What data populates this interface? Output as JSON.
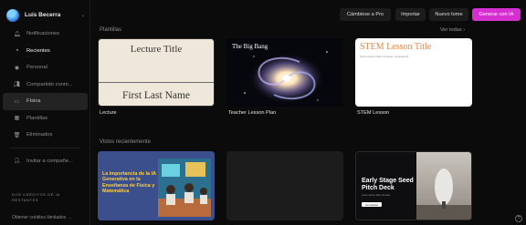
{
  "user": {
    "name": "Luis Becerra"
  },
  "sidebar": {
    "items": [
      {
        "label": "Notificaciones",
        "icon": "bell-icon"
      },
      {
        "label": "Recientes",
        "icon": "clock-icon"
      },
      {
        "label": "Personal",
        "icon": "person-icon"
      },
      {
        "label": "Compartido conm...",
        "icon": "people-icon"
      },
      {
        "label": "Física",
        "icon": "folder-icon"
      },
      {
        "label": "Plantillas",
        "icon": "grid-icon"
      },
      {
        "label": "Eliminados",
        "icon": "trash-icon"
      },
      {
        "label": "Invitar a compañe...",
        "icon": "invite-icon"
      }
    ],
    "credits_text": "DOS CRÉDITOS DE IA RESTANTES",
    "credits_link": "Obtener créditos ilimitados →"
  },
  "topbar": {
    "upgrade_label": "Cámbiese a Pro",
    "import_label": "Importar",
    "new_label": "Nuevo tome",
    "generate_label": "Generar con IA",
    "generate_color": "#d62fd0"
  },
  "templates": {
    "section_label": "Plantillas",
    "see_all": "Ver todas ›",
    "cards": [
      {
        "caption": "Lecture",
        "thumb_title": "Lecture Title",
        "thumb_footer": "First Last Name"
      },
      {
        "caption": "Teacher Lesson Plan",
        "thumb_title": "The Big Bang"
      },
      {
        "caption": "STEM Lesson",
        "thumb_title": "STEM Lesson Title",
        "thumb_sub": "Lorem ipsum dolor sit amet, consectetur"
      }
    ]
  },
  "recent": {
    "section_label": "Vistos recientemente",
    "cards": [
      {
        "thumb_title": "La Importancia de la IA Generativa en la Enseñanza de Física y Matemática"
      },
      {
        "thumb_title": ""
      },
      {
        "thumb_title": "Early Stage Seed Pitch Deck",
        "thumb_sub": "Lorem ipsum dolor sit amet",
        "thumb_button": "Get started"
      }
    ]
  },
  "help_label": "?"
}
